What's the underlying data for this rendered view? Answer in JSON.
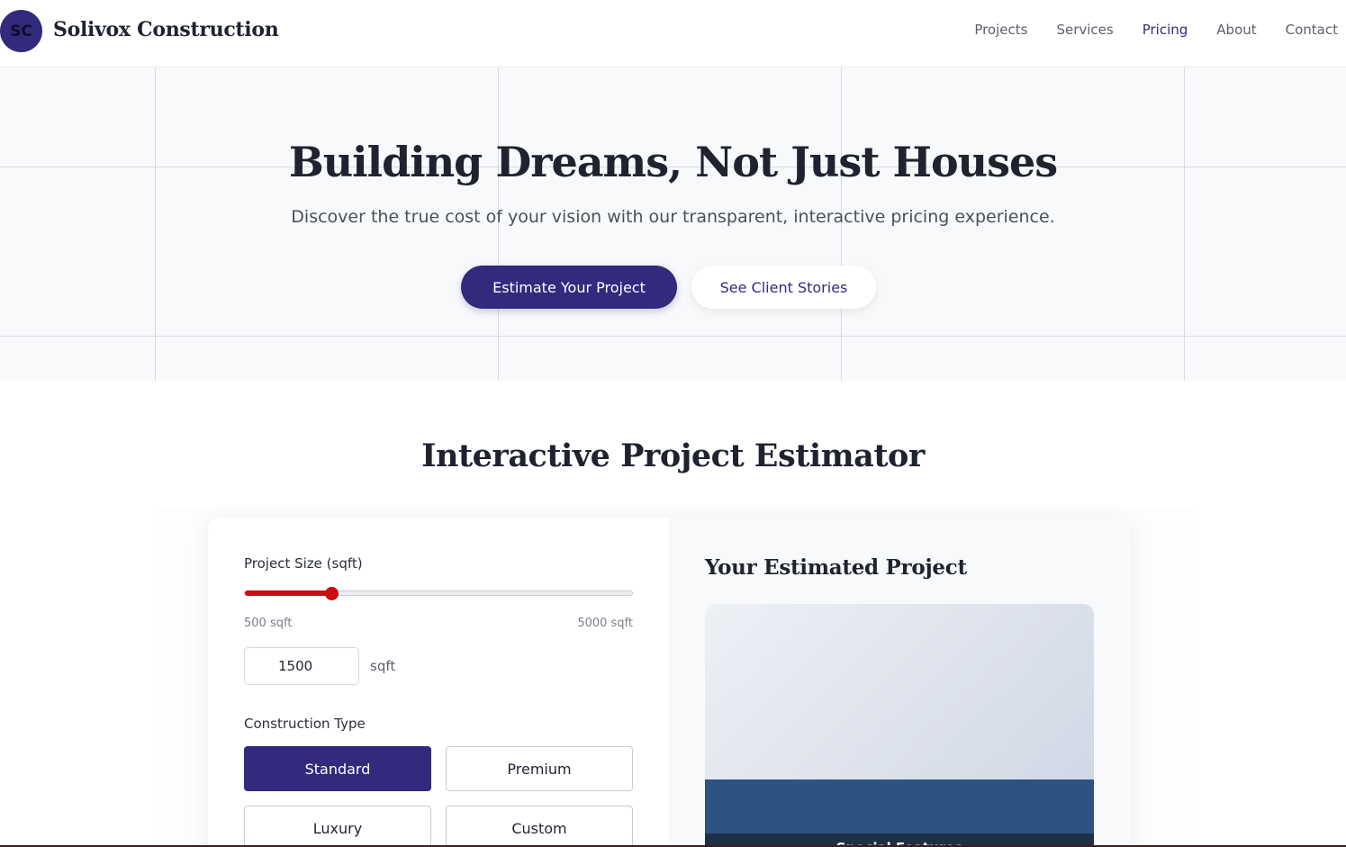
{
  "header": {
    "logo_initials": "SC",
    "brand": "Solivox Construction",
    "nav": [
      {
        "label": "Projects",
        "active": false
      },
      {
        "label": "Services",
        "active": false
      },
      {
        "label": "Pricing",
        "active": true
      },
      {
        "label": "About",
        "active": false
      },
      {
        "label": "Contact",
        "active": false
      }
    ]
  },
  "hero": {
    "title": "Building Dreams, Not Just Houses",
    "subtitle": "Discover the true cost of your vision with our transparent, interactive pricing experience.",
    "primary_cta": "Estimate Your Project",
    "secondary_cta": "See Client Stories"
  },
  "estimator": {
    "title": "Interactive Project Estimator",
    "size_label": "Project Size (sqft)",
    "size_min": 500,
    "size_max": 5000,
    "size_min_label": "500 sqft",
    "size_max_label": "5000 sqft",
    "size_value": "1500",
    "size_unit": "sqft",
    "type_label": "Construction Type",
    "types": [
      {
        "label": "Standard",
        "selected": true
      },
      {
        "label": "Premium",
        "selected": false
      },
      {
        "label": "Luxury",
        "selected": false
      },
      {
        "label": "Custom",
        "selected": false
      }
    ],
    "result_title": "Your Estimated Project",
    "preview_caption": "Special Features"
  },
  "colors": {
    "brand": "#322a7d",
    "slider": "#cc0c13",
    "preview_band": "#2d5382"
  }
}
